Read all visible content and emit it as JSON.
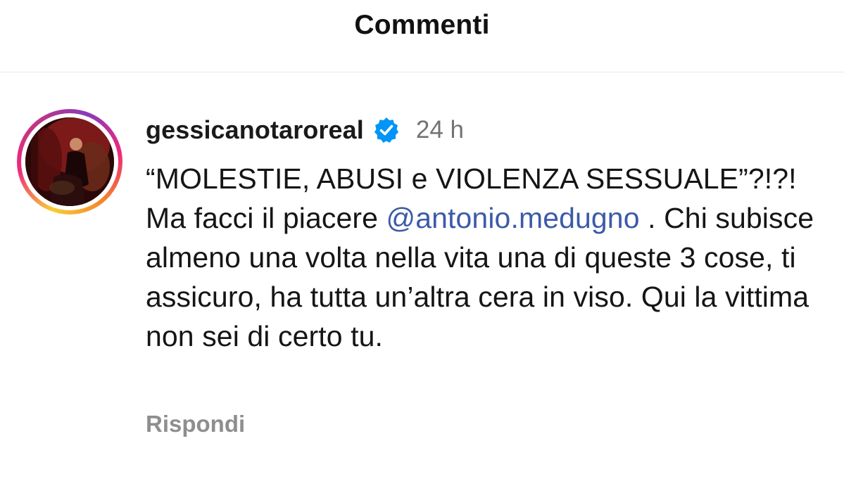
{
  "header": {
    "title": "Commenti"
  },
  "comment": {
    "username": "gessicanotaroreal",
    "verified_icon": "verified-badge-icon",
    "time": "24 h",
    "text_part1": "“MOLESTIE, ABUSI e VIOLENZA SESSUALE”?!?! Ma facci il piacere ",
    "mention": "@antonio.medugno",
    "text_part2": " . Chi subisce almeno una volta nella vita una di queste 3 cose, ti assicuro, ha tutta un’altra cera in viso. Qui la vittima non sei di certo tu.",
    "reply_label": "Rispondi"
  },
  "colors": {
    "verified_blue": "#0095f6",
    "mention_blue": "#3d5aa8",
    "muted_gray": "#737373"
  }
}
